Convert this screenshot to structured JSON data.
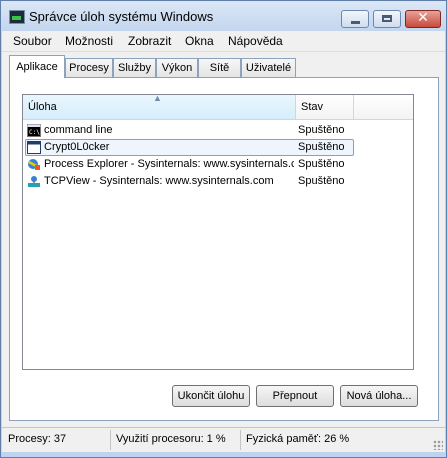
{
  "window": {
    "title": "Správce úloh systému Windows",
    "close_glyph": "✕"
  },
  "menu": [
    "Soubor",
    "Možnosti",
    "Zobrazit",
    "Okna",
    "Nápověda"
  ],
  "tabs": [
    "Aplikace",
    "Procesy",
    "Služby",
    "Výkon",
    "Sítě",
    "Uživatelé"
  ],
  "active_tab": "Aplikace",
  "list": {
    "columns": {
      "task": "Úloha",
      "status": "Stav"
    },
    "rows": [
      {
        "name": "command line",
        "status": "Spuštěno",
        "icon": "console-icon",
        "selected": false
      },
      {
        "name": "Crypt0L0cker",
        "status": "Spuštěno",
        "icon": "window-icon",
        "selected": true
      },
      {
        "name": "Process Explorer - Sysinternals: www.sysinternals.com",
        "status": "Spuštěno",
        "icon": "process-explorer-icon",
        "selected": false
      },
      {
        "name": "TCPView - Sysinternals: www.sysinternals.com",
        "status": "Spuštěno",
        "icon": "tcpview-icon",
        "selected": false
      }
    ]
  },
  "buttons": {
    "end_task": "Ukončit úlohu",
    "switch_to": "Přepnout",
    "new_task": "Nová úloha..."
  },
  "status": {
    "processes": "Procesy: 37",
    "cpu": "Využití procesoru: 1 %",
    "memory": "Fyzická paměť: 26 %"
  }
}
